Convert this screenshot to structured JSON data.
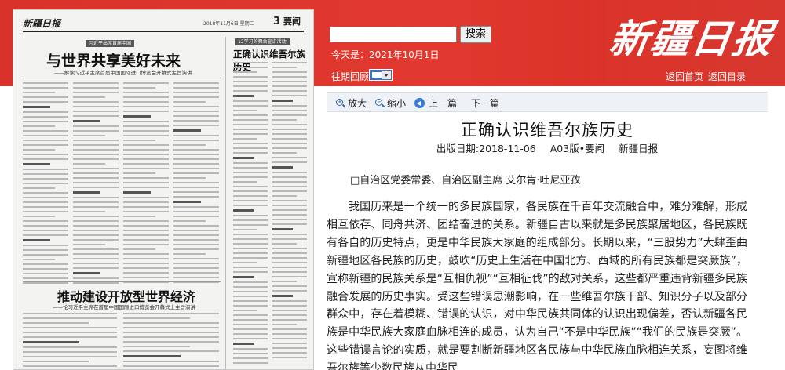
{
  "header": {
    "logo_text": "新疆日报",
    "search": {
      "placeholder": "",
      "value": "",
      "button_label": "搜索"
    },
    "today_text": "今天是：2021年10月1日",
    "history_label": "往期回顾",
    "nav": {
      "home": "返回首页",
      "directory": "返回目录"
    }
  },
  "newspaper_thumb": {
    "logo": "新疆日报",
    "date_line": "2018年11月6日 星期二",
    "page_no": "3",
    "section": "要闻",
    "story1": {
      "tag": "习近平出席首届中国",
      "headline": "与世界共享美好未来",
      "sub": "——解读习近平主席首届中国国际进口博览会开幕式主旨演讲"
    },
    "story2": {
      "headline": "推动建设开放型世界经济",
      "sub": "——论习近平主席在首届中国国际进口博览会开幕式上主旨演讲"
    },
    "story3": {
      "tag": "12学习的舞台宣讲活动",
      "headline": "正确认识维吾尔族历史"
    }
  },
  "toolbar": {
    "zoom_in": "放大",
    "zoom_out": "缩小",
    "prev": "上一篇",
    "next": "下一篇"
  },
  "article": {
    "title": "正确认识维吾尔族历史",
    "meta": {
      "date": "出版日期:2018-11-06",
      "edition": "A03版•要闻",
      "paper": "新疆日报"
    },
    "author": "□自治区党委常委、自治区副主席 艾尔肯·吐尼亚孜",
    "body": "我国历来是一个统一的多民族国家，各民族在千百年交流融合中，难分难解，形成相互依存、同舟共济、团结奋进的关系。新疆自古以来就是多民族聚居地区，各民族既有各自的历史特点，更是中华民族大家庭的组成部分。长期以来，“三股势力”大肆歪曲新疆地区各民族的历史，鼓吹“历史上生活在中国北方、西域的所有民族都是突厥族”，宣称新疆的民族关系是“互相仇视”“互相征伐”的敌对关系，这些都严重违背新疆多民族融合发展的历史事实。受这些错误思潮影响，在一些维吾尔族干部、知识分子以及部分群众中，存在着模糊、错误的认识，对中华民族共同体的认识出现偏差，否认新疆各民族是中华民族大家庭血脉相连的成员，认为自己“不是中华民族”“我们的民族是突厥”。这些错误言论的实质，就是要割断新疆地区各民族与中华民族血脉相连关系，妄图将维吾尔族等少数民族从中华民"
  },
  "colors": {
    "header_red": "#dc342b",
    "toolbar_bg": "#eef2f7",
    "icon_blue": "#2e63b8"
  }
}
